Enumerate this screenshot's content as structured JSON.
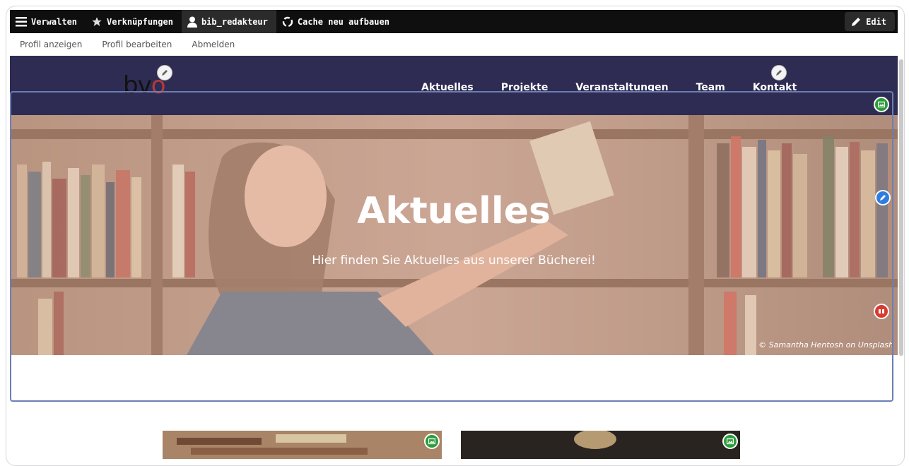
{
  "toolbar": {
    "manage_label": "Verwalten",
    "shortcuts_label": "Verknüpfungen",
    "user_label": "bib_redakteur",
    "cache_label": "Cache neu aufbauen",
    "edit_label": "Edit"
  },
  "user_menu": {
    "items": [
      {
        "label": "Profil anzeigen"
      },
      {
        "label": "Profil bearbeiten"
      },
      {
        "label": "Abmelden"
      }
    ]
  },
  "header": {
    "logo_main": "bv",
    "logo_accent": "o",
    "nav": [
      {
        "label": "Aktuelles"
      },
      {
        "label": "Projekte"
      },
      {
        "label": "Veranstaltungen"
      },
      {
        "label": "Team"
      },
      {
        "label": "Kontakt"
      }
    ]
  },
  "hero": {
    "title": "Aktuelles",
    "subtitle": "Hier finden Sie Aktuelles aus unserer Bücherei!",
    "credit": "© Samantha Hentosh on Unsplash"
  },
  "colors": {
    "header_bg": "#2e2c52",
    "toolbar_bg": "#0f0f0f",
    "edit_region": "#6b7fb5",
    "media_button": "#2d9c3c",
    "edit_button": "#2f7de0",
    "remove_button": "#d93a2f"
  }
}
